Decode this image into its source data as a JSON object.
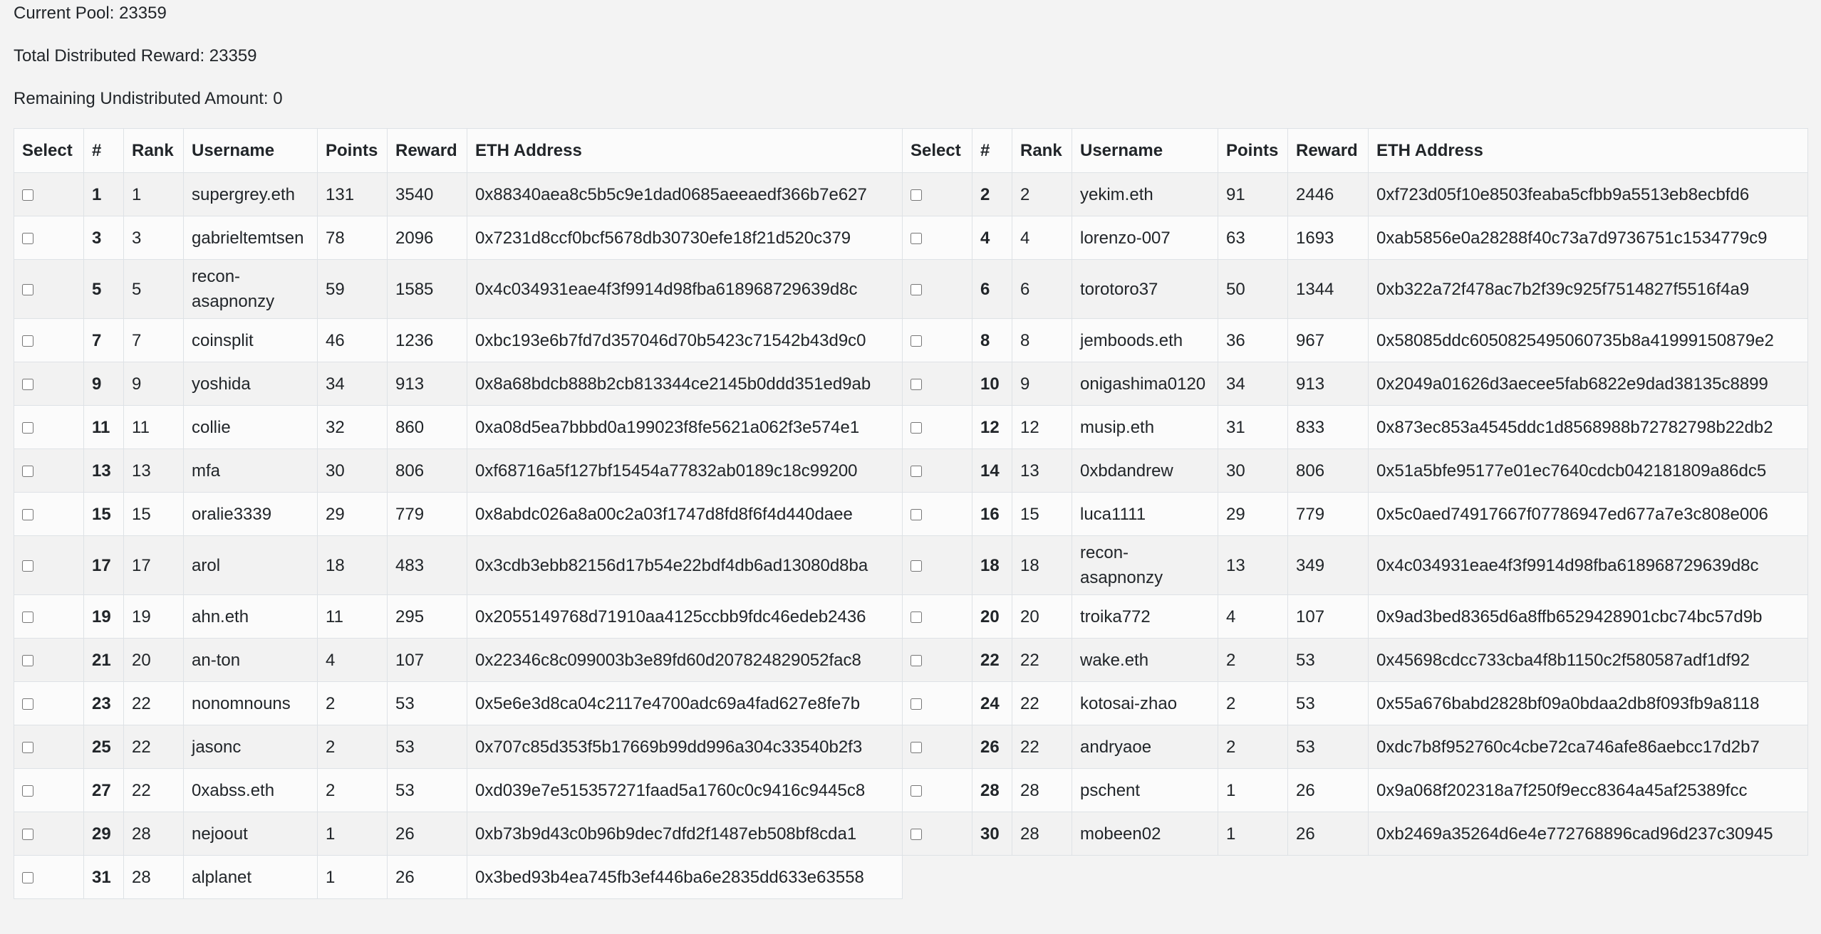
{
  "summary": {
    "current_pool": "Current Pool: 23359",
    "total_distributed": "Total Distributed Reward: 23359",
    "remaining": "Remaining Undistributed Amount: 0"
  },
  "columns": [
    "Select",
    "#",
    "Rank",
    "Username",
    "Points",
    "Reward",
    "ETH Address"
  ],
  "entries": [
    {
      "num": "1",
      "rank": "1",
      "username": "supergrey.eth",
      "points": "131",
      "reward": "3540",
      "address": "0x88340aea8c5b5c9e1dad0685aeeaedf366b7e627"
    },
    {
      "num": "2",
      "rank": "2",
      "username": "yekim.eth",
      "points": "91",
      "reward": "2446",
      "address": "0xf723d05f10e8503feaba5cfbb9a5513eb8ecbfd6"
    },
    {
      "num": "3",
      "rank": "3",
      "username": "gabrieltemtsen",
      "points": "78",
      "reward": "2096",
      "address": "0x7231d8ccf0bcf5678db30730efe18f21d520c379"
    },
    {
      "num": "4",
      "rank": "4",
      "username": "lorenzo-007",
      "points": "63",
      "reward": "1693",
      "address": "0xab5856e0a28288f40c73a7d9736751c1534779c9"
    },
    {
      "num": "5",
      "rank": "5",
      "username": "recon-asapnonzy",
      "points": "59",
      "reward": "1585",
      "address": "0x4c034931eae4f3f9914d98fba618968729639d8c"
    },
    {
      "num": "6",
      "rank": "6",
      "username": "torotoro37",
      "points": "50",
      "reward": "1344",
      "address": "0xb322a72f478ac7b2f39c925f7514827f5516f4a9"
    },
    {
      "num": "7",
      "rank": "7",
      "username": "coinsplit",
      "points": "46",
      "reward": "1236",
      "address": "0xbc193e6b7fd7d357046d70b5423c71542b43d9c0"
    },
    {
      "num": "8",
      "rank": "8",
      "username": "jemboods.eth",
      "points": "36",
      "reward": "967",
      "address": "0x58085ddc6050825495060735b8a41999150879e2"
    },
    {
      "num": "9",
      "rank": "9",
      "username": "yoshida",
      "points": "34",
      "reward": "913",
      "address": "0x8a68bdcb888b2cb813344ce2145b0ddd351ed9ab"
    },
    {
      "num": "10",
      "rank": "9",
      "username": "onigashima0120",
      "points": "34",
      "reward": "913",
      "address": "0x2049a01626d3aecee5fab6822e9dad38135c8899"
    },
    {
      "num": "11",
      "rank": "11",
      "username": "collie",
      "points": "32",
      "reward": "860",
      "address": "0xa08d5ea7bbbd0a199023f8fe5621a062f3e574e1"
    },
    {
      "num": "12",
      "rank": "12",
      "username": "musip.eth",
      "points": "31",
      "reward": "833",
      "address": "0x873ec853a4545ddc1d8568988b72782798b22db2"
    },
    {
      "num": "13",
      "rank": "13",
      "username": "mfa",
      "points": "30",
      "reward": "806",
      "address": "0xf68716a5f127bf15454a77832ab0189c18c99200"
    },
    {
      "num": "14",
      "rank": "13",
      "username": "0xbdandrew",
      "points": "30",
      "reward": "806",
      "address": "0x51a5bfe95177e01ec7640cdcb042181809a86dc5"
    },
    {
      "num": "15",
      "rank": "15",
      "username": "oralie3339",
      "points": "29",
      "reward": "779",
      "address": "0x8abdc026a8a00c2a03f1747d8fd8f6f4d440daee"
    },
    {
      "num": "16",
      "rank": "15",
      "username": "luca1111",
      "points": "29",
      "reward": "779",
      "address": "0x5c0aed74917667f07786947ed677a7e3c808e006"
    },
    {
      "num": "17",
      "rank": "17",
      "username": "arol",
      "points": "18",
      "reward": "483",
      "address": "0x3cdb3ebb82156d17b54e22bdf4db6ad13080d8ba"
    },
    {
      "num": "18",
      "rank": "18",
      "username": "recon-asapnonzy",
      "points": "13",
      "reward": "349",
      "address": "0x4c034931eae4f3f9914d98fba618968729639d8c"
    },
    {
      "num": "19",
      "rank": "19",
      "username": "ahn.eth",
      "points": "11",
      "reward": "295",
      "address": "0x2055149768d71910aa4125ccbb9fdc46edeb2436"
    },
    {
      "num": "20",
      "rank": "20",
      "username": "troika772",
      "points": "4",
      "reward": "107",
      "address": "0x9ad3bed8365d6a8ffb6529428901cbc74bc57d9b"
    },
    {
      "num": "21",
      "rank": "20",
      "username": "an-ton",
      "points": "4",
      "reward": "107",
      "address": "0x22346c8c099003b3e89fd60d207824829052fac8"
    },
    {
      "num": "22",
      "rank": "22",
      "username": "wake.eth",
      "points": "2",
      "reward": "53",
      "address": "0x45698cdcc733cba4f8b1150c2f580587adf1df92"
    },
    {
      "num": "23",
      "rank": "22",
      "username": "nonomnouns",
      "points": "2",
      "reward": "53",
      "address": "0x5e6e3d8ca04c2117e4700adc69a4fad627e8fe7b"
    },
    {
      "num": "24",
      "rank": "22",
      "username": "kotosai-zhao",
      "points": "2",
      "reward": "53",
      "address": "0x55a676babd2828bf09a0bdaa2db8f093fb9a8118"
    },
    {
      "num": "25",
      "rank": "22",
      "username": "jasonc",
      "points": "2",
      "reward": "53",
      "address": "0x707c85d353f5b17669b99dd996a304c33540b2f3"
    },
    {
      "num": "26",
      "rank": "22",
      "username": "andryaoe",
      "points": "2",
      "reward": "53",
      "address": "0xdc7b8f952760c4cbe72ca746afe86aebcc17d2b7"
    },
    {
      "num": "27",
      "rank": "22",
      "username": "0xabss.eth",
      "points": "2",
      "reward": "53",
      "address": "0xd039e7e515357271faad5a1760c0c9416c9445c8"
    },
    {
      "num": "28",
      "rank": "28",
      "username": "pschent",
      "points": "1",
      "reward": "26",
      "address": "0x9a068f202318a7f250f9ecc8364a45af25389fcc"
    },
    {
      "num": "29",
      "rank": "28",
      "username": "nejoout",
      "points": "1",
      "reward": "26",
      "address": "0xb73b9d43c0b96b9dec7dfd2f1487eb508bf8cda1"
    },
    {
      "num": "30",
      "rank": "28",
      "username": "mobeen02",
      "points": "1",
      "reward": "26",
      "address": "0xb2469a35264d6e4e772768896cad96d237c30945"
    },
    {
      "num": "31",
      "rank": "28",
      "username": "alplanet",
      "points": "1",
      "reward": "26",
      "address": "0x3bed93b4ea745fb3ef446ba6e2835dd633e63558"
    }
  ]
}
